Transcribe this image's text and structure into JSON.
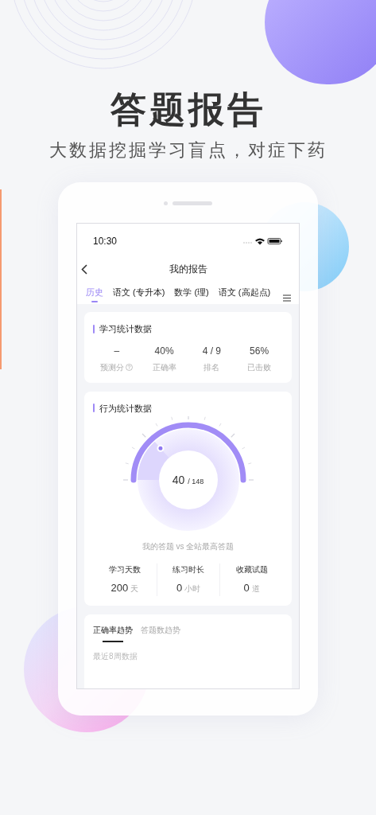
{
  "headline": "答题报告",
  "subtitle": "大数据挖掘学习盲点，对症下药",
  "status_bar": {
    "time": "10:30"
  },
  "nav": {
    "title": "我的报告"
  },
  "tabs": [
    {
      "label": "历史",
      "selected": true
    },
    {
      "label": "语文 (专升本)",
      "selected": false
    },
    {
      "label": "数学 (理)",
      "selected": false
    },
    {
      "label": "语文 (高起点)",
      "selected": false
    }
  ],
  "study_stats": {
    "title": "学习统计数据",
    "items": [
      {
        "value": "–",
        "label": "预测分",
        "help": true
      },
      {
        "value": "40%",
        "label": "正确率",
        "help": false
      },
      {
        "value": "4 / 9",
        "label": "排名",
        "help": false
      },
      {
        "value": "56%",
        "label": "已击败",
        "help": false
      }
    ]
  },
  "behavior_stats": {
    "title": "行为统计数据",
    "gauge": {
      "mine": "40",
      "total": "/ 148",
      "level": 0.27
    },
    "caption": "我的答题 vs 全站最高答题",
    "items": [
      {
        "label": "学习天数",
        "value": "200",
        "unit": "天"
      },
      {
        "label": "练习时长",
        "value": "0",
        "unit": "小时"
      },
      {
        "label": "收藏试题",
        "value": "0",
        "unit": "道"
      }
    ]
  },
  "trend": {
    "tabs": [
      {
        "label": "正确率趋势",
        "selected": true
      },
      {
        "label": "答题数趋势",
        "selected": false
      }
    ],
    "note": "最近8周数据"
  }
}
